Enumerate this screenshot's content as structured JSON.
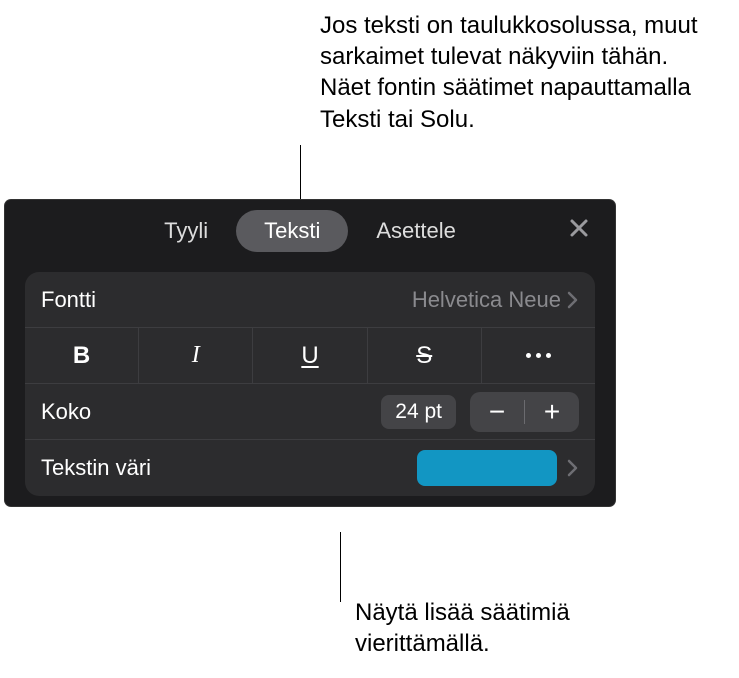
{
  "annotations": {
    "top": "Jos teksti on taulukkosolussa, muut sarkaimet tulevat näkyviin tähän. Näet fontin säätimet napauttamalla Teksti tai Solu.",
    "bottom": "Näytä lisää säätimiä vierittämällä."
  },
  "tabs": {
    "style": "Tyyli",
    "text": "Teksti",
    "arrange": "Asettele"
  },
  "font": {
    "label": "Fontti",
    "value": "Helvetica Neue"
  },
  "format_buttons": {
    "bold": "B",
    "italic": "I",
    "underline": "U",
    "strike": "S"
  },
  "size": {
    "label": "Koko",
    "value": "24 pt"
  },
  "text_color": {
    "label": "Tekstin väri",
    "swatch": "#1296c3"
  }
}
